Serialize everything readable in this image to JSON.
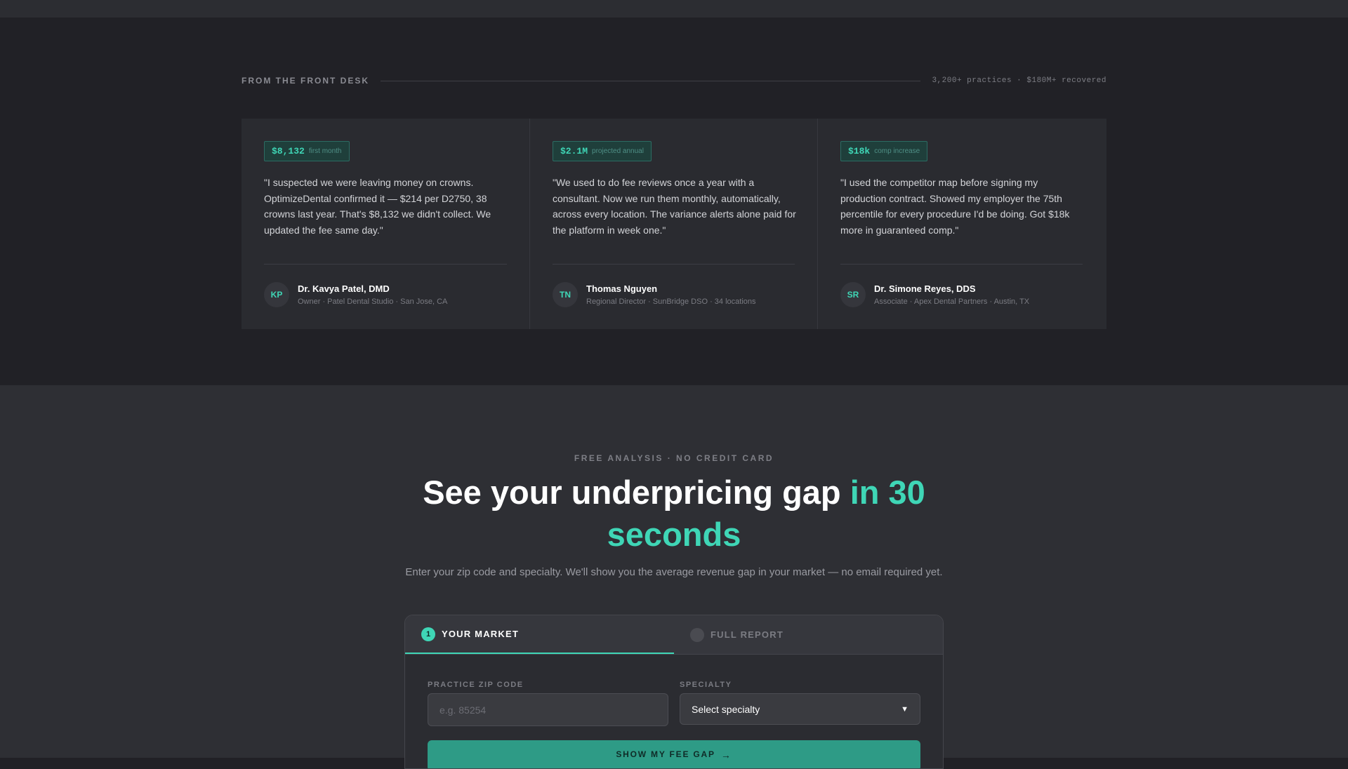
{
  "front_desk": {
    "title": "FROM THE FRONT DESK",
    "stats": "3,200+ practices · $180M+ recovered"
  },
  "testimonials": [
    {
      "metric_value": "$8,132",
      "metric_unit": "first month",
      "quote": "\"I suspected we were leaving money on crowns. OptimizeDental confirmed it — $214 per D2750, 38 crowns last year. That's $8,132 we didn't collect. We updated the fee same day.\"",
      "initials": "KP",
      "name": "Dr. Kavya Patel, DMD",
      "role": "Owner · Patel Dental Studio · San Jose, CA"
    },
    {
      "metric_value": "$2.1M",
      "metric_unit": "projected annual",
      "quote": "\"We used to do fee reviews once a year with a consultant. Now we run them monthly, automatically, across every location. The variance alerts alone paid for the platform in week one.\"",
      "initials": "TN",
      "name": "Thomas Nguyen",
      "role": "Regional Director · SunBridge DSO · 34 locations"
    },
    {
      "metric_value": "$18k",
      "metric_unit": "comp increase",
      "quote": "\"I used the competitor map before signing my production contract. Showed my employer the 75th percentile for every procedure I'd be doing. Got $18k more in guaranteed comp.\"",
      "initials": "SR",
      "name": "Dr. Simone Reyes, DDS",
      "role": "Associate · Apex Dental Partners · Austin, TX"
    }
  ],
  "analysis": {
    "eyebrow": "FREE ANALYSIS · NO CREDIT CARD",
    "headline_main": "See your underpricing gap ",
    "headline_accent": "in 30 seconds",
    "subtitle": "Enter your zip code and specialty. We'll show you the average revenue gap in your market — no email required yet."
  },
  "form": {
    "steps": [
      {
        "number": "1",
        "label": "YOUR MARKET"
      },
      {
        "number": "",
        "label": "FULL REPORT"
      }
    ],
    "zip_label": "PRACTICE ZIP CODE",
    "zip_placeholder": "e.g. 85254",
    "zip_value": "",
    "specialty_label": "SPECIALTY",
    "specialty_selected": "Select specialty",
    "cta_label": "SHOW MY FEE GAP"
  },
  "colors": {
    "accent": "#3fd6b6",
    "cta": "#2e9b86",
    "bg_top": "#212126",
    "bg_bottom": "#2e2f34"
  }
}
